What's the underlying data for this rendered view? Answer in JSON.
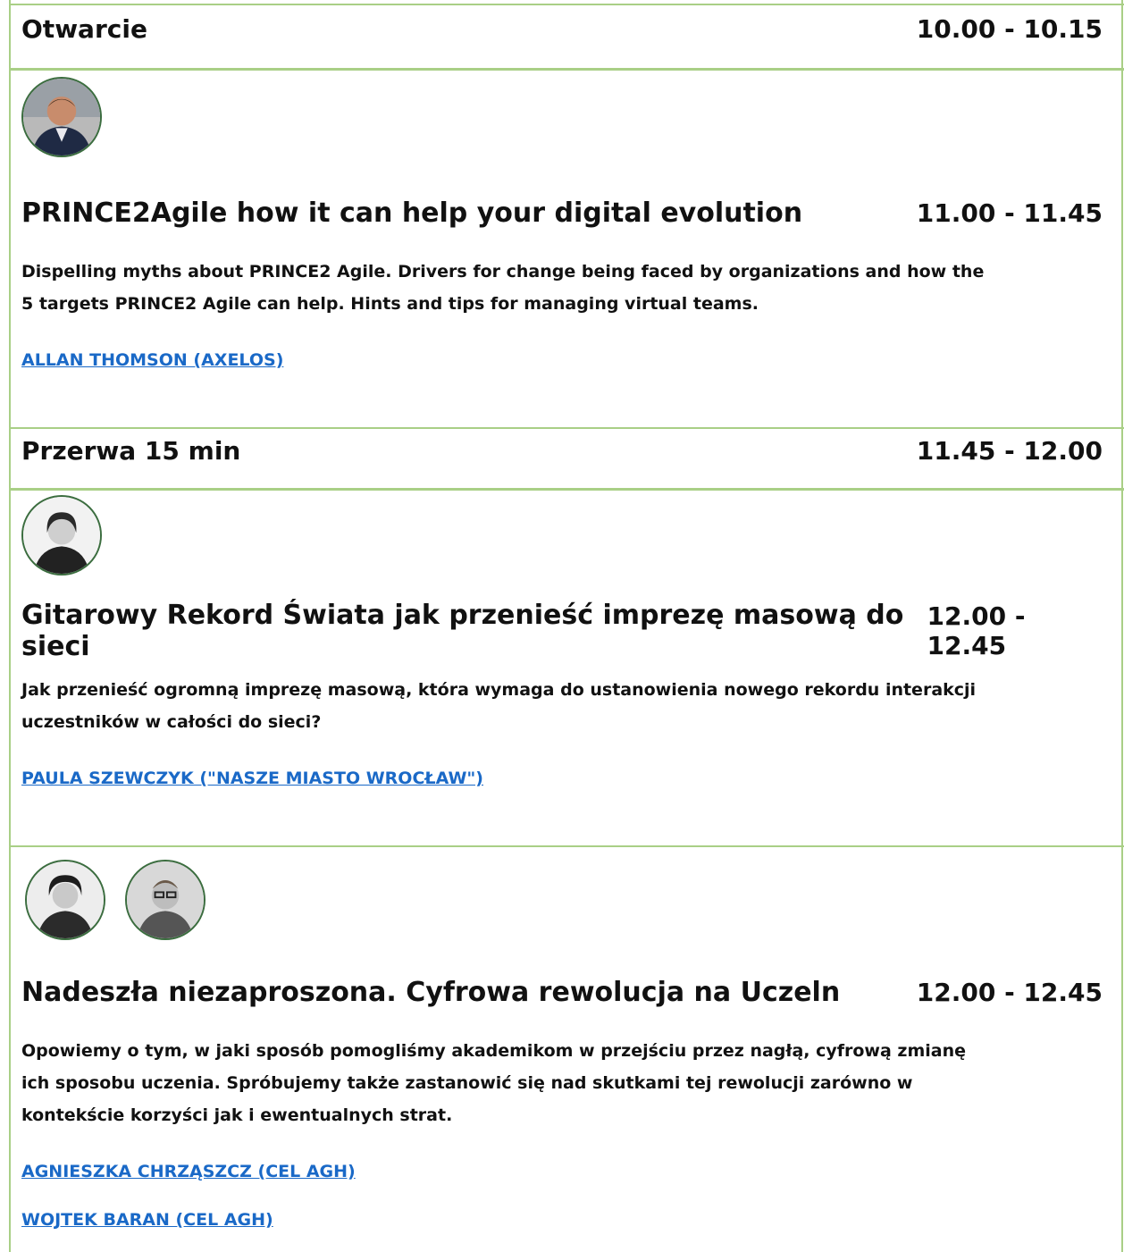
{
  "sessions": [
    {
      "title": "Otwarcie",
      "time": "10.00 - 10.15"
    },
    {
      "title": "PRINCE2Agile how it can help your digital evolution",
      "time": "11.00 - 11.45",
      "desc_lines": [
        "Dispelling myths about PRINCE2 Agile. Drivers for change being faced by organizations and how the",
        "5 targets PRINCE2 Agile can help. Hints and tips for managing virtual teams."
      ],
      "speakers": [
        "ALLAN THOMSON (AXELOS)"
      ]
    },
    {
      "title": "Przerwa 15 min",
      "time": "11.45 - 12.00"
    },
    {
      "title": "Gitarowy Rekord Świata jak przenieść imprezę masową do sieci",
      "time": "12.00 - 12.45",
      "desc_lines": [
        "Jak przenieść ogromną imprezę masową, która wymaga do ustanowienia nowego rekordu interakcji",
        "uczestników w całości do sieci?"
      ],
      "speakers": [
        "PAULA SZEWCZYK (\"NASZE MIASTO WROCŁAW\")"
      ]
    },
    {
      "title": "Nadeszła niezaproszona. Cyfrowa rewolucja na Uczeln",
      "time": "12.00 - 12.45",
      "desc_lines": [
        "Opowiemy o tym, w jaki sposób pomogliśmy akademikom w przejściu przez nagłą, cyfrową zmianę",
        "ich sposobu uczenia. Spróbujemy także zastanowić się nad skutkami tej rewolucji zarówno w",
        "kontekście korzyści jak i ewentualnych strat."
      ],
      "speakers": [
        "AGNIESZKA CHRZĄSZCZ (CEL AGH)",
        "WOJTEK BARAN (CEL AGH)"
      ]
    }
  ],
  "colors": {
    "divider": "#a9cf86",
    "link": "#1a69c7",
    "avatar_ring": "#3b6d3f"
  }
}
